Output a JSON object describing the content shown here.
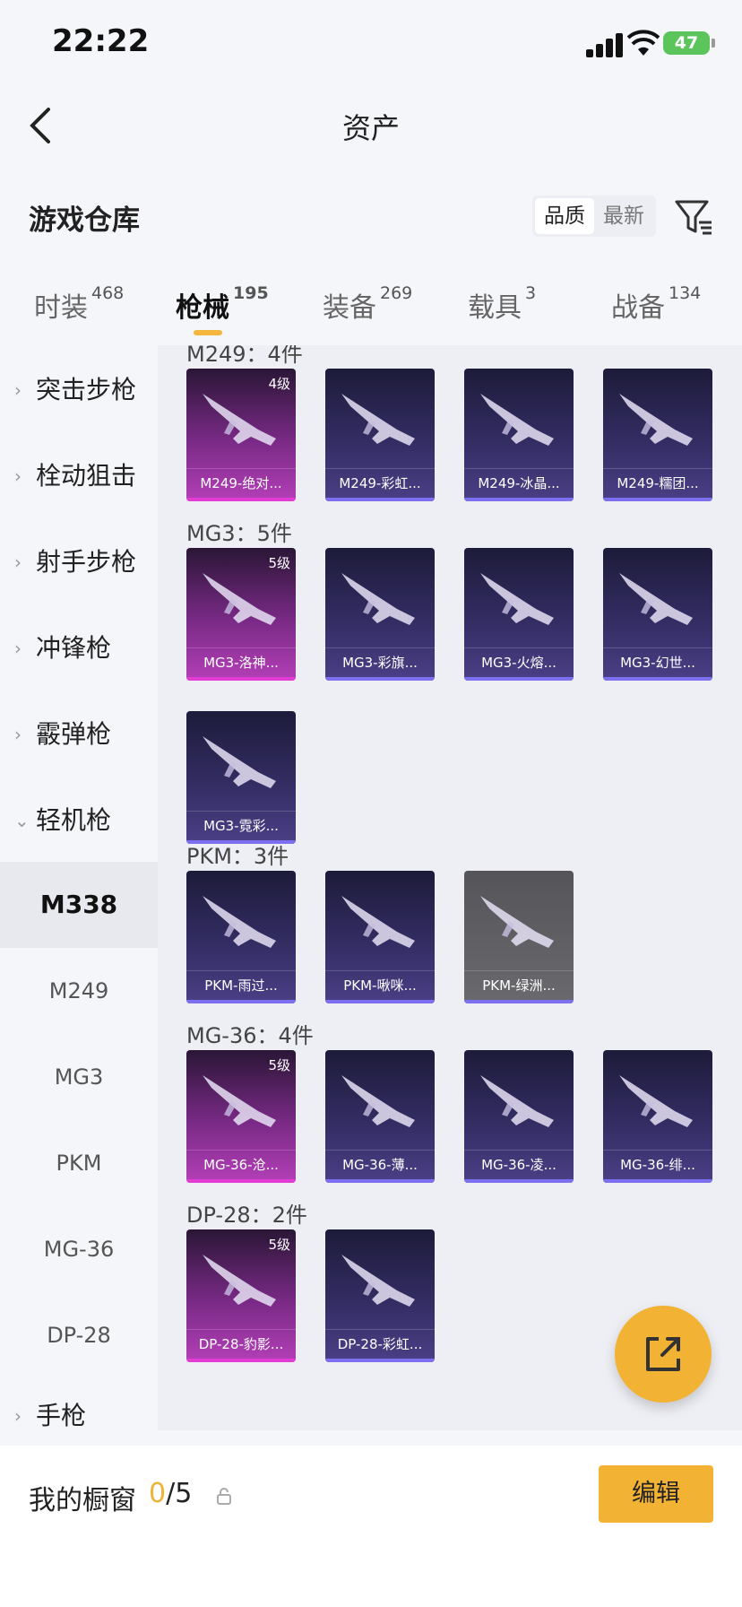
{
  "status": {
    "time": "22:22",
    "battery": "47"
  },
  "nav": {
    "title": "资产"
  },
  "header": {
    "title": "游戏仓库",
    "sort_options": [
      "品质",
      "最新"
    ],
    "active_sort": "品质"
  },
  "tabs": [
    {
      "label": "时装",
      "count": "468"
    },
    {
      "label": "枪械",
      "count": "195",
      "active": true
    },
    {
      "label": "装备",
      "count": "269"
    },
    {
      "label": "载具",
      "count": "3"
    },
    {
      "label": "战备",
      "count": "134"
    }
  ],
  "sidebar": {
    "categories": [
      "突击步枪",
      "栓动狙击",
      "射手步枪",
      "冲锋枪",
      "霰弹枪",
      "轻机枪",
      "手枪"
    ],
    "subitems": [
      "M338",
      "M249",
      "MG3",
      "PKM",
      "MG-36",
      "DP-28"
    ],
    "selected_sub": "M338"
  },
  "groups": [
    {
      "title": "M249：4件",
      "items": [
        {
          "name": "M249-绝对...",
          "rarity": "gold",
          "level": "4级"
        },
        {
          "name": "M249-彩虹...",
          "rarity": "purple"
        },
        {
          "name": "M249-冰晶...",
          "rarity": "purple"
        },
        {
          "name": "M249-糯团...",
          "rarity": "purple"
        }
      ]
    },
    {
      "title": "MG3：5件",
      "items": [
        {
          "name": "MG3-洛神...",
          "rarity": "gold",
          "level": "5级"
        },
        {
          "name": "MG3-彩旗...",
          "rarity": "purple"
        },
        {
          "name": "MG3-火熔...",
          "rarity": "purple"
        },
        {
          "name": "MG3-幻世...",
          "rarity": "purple"
        },
        {
          "name": "MG3-霓彩...",
          "rarity": "purple"
        }
      ]
    },
    {
      "title": "PKM：3件",
      "items": [
        {
          "name": "PKM-雨过...",
          "rarity": "purple"
        },
        {
          "name": "PKM-啾咪...",
          "rarity": "purple"
        },
        {
          "name": "PKM-绿洲...",
          "rarity": "grey"
        }
      ]
    },
    {
      "title": "MG-36：4件",
      "items": [
        {
          "name": "MG-36-沧...",
          "rarity": "gold",
          "level": "5级"
        },
        {
          "name": "MG-36-薄...",
          "rarity": "purple"
        },
        {
          "name": "MG-36-凌...",
          "rarity": "purple"
        },
        {
          "name": "MG-36-绯...",
          "rarity": "purple"
        }
      ]
    },
    {
      "title": "DP-28：2件",
      "items": [
        {
          "name": "DP-28-豹影...",
          "rarity": "gold",
          "level": "5级"
        },
        {
          "name": "DP-28-彩虹...",
          "rarity": "purple"
        }
      ]
    }
  ],
  "showcase": {
    "label": "我的橱窗",
    "current": "0",
    "total": "/5",
    "edit_label": "编辑"
  },
  "colors": {
    "accent": "#f2b233",
    "gold_card": "#b43fb8",
    "purple_card": "#4b3f86"
  }
}
